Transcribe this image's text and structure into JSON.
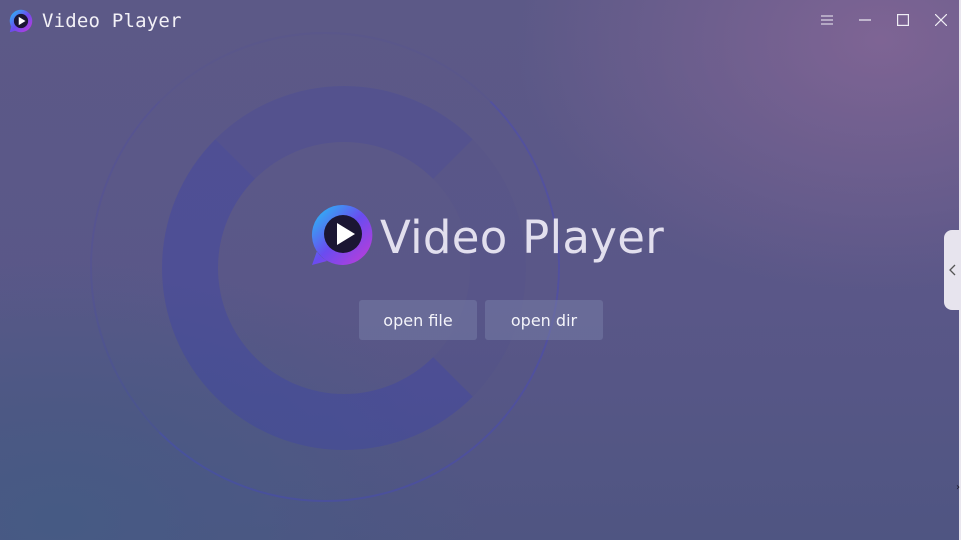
{
  "window": {
    "title": "Video Player",
    "controls": {
      "menu_icon": "hamburger-menu-icon",
      "minimize_icon": "minimize-icon",
      "maximize_icon": "maximize-icon",
      "close_icon": "close-icon"
    }
  },
  "main": {
    "logo_text": "Video Player",
    "open_file_label": "open file",
    "open_dir_label": "open dir"
  },
  "side_panel": {
    "toggle_icon": "chevron-left-icon"
  },
  "colors": {
    "logo_gradient": [
      "#21c7f5",
      "#6a4cf0",
      "#c63bd6"
    ],
    "button_bg": "#767ca5"
  }
}
